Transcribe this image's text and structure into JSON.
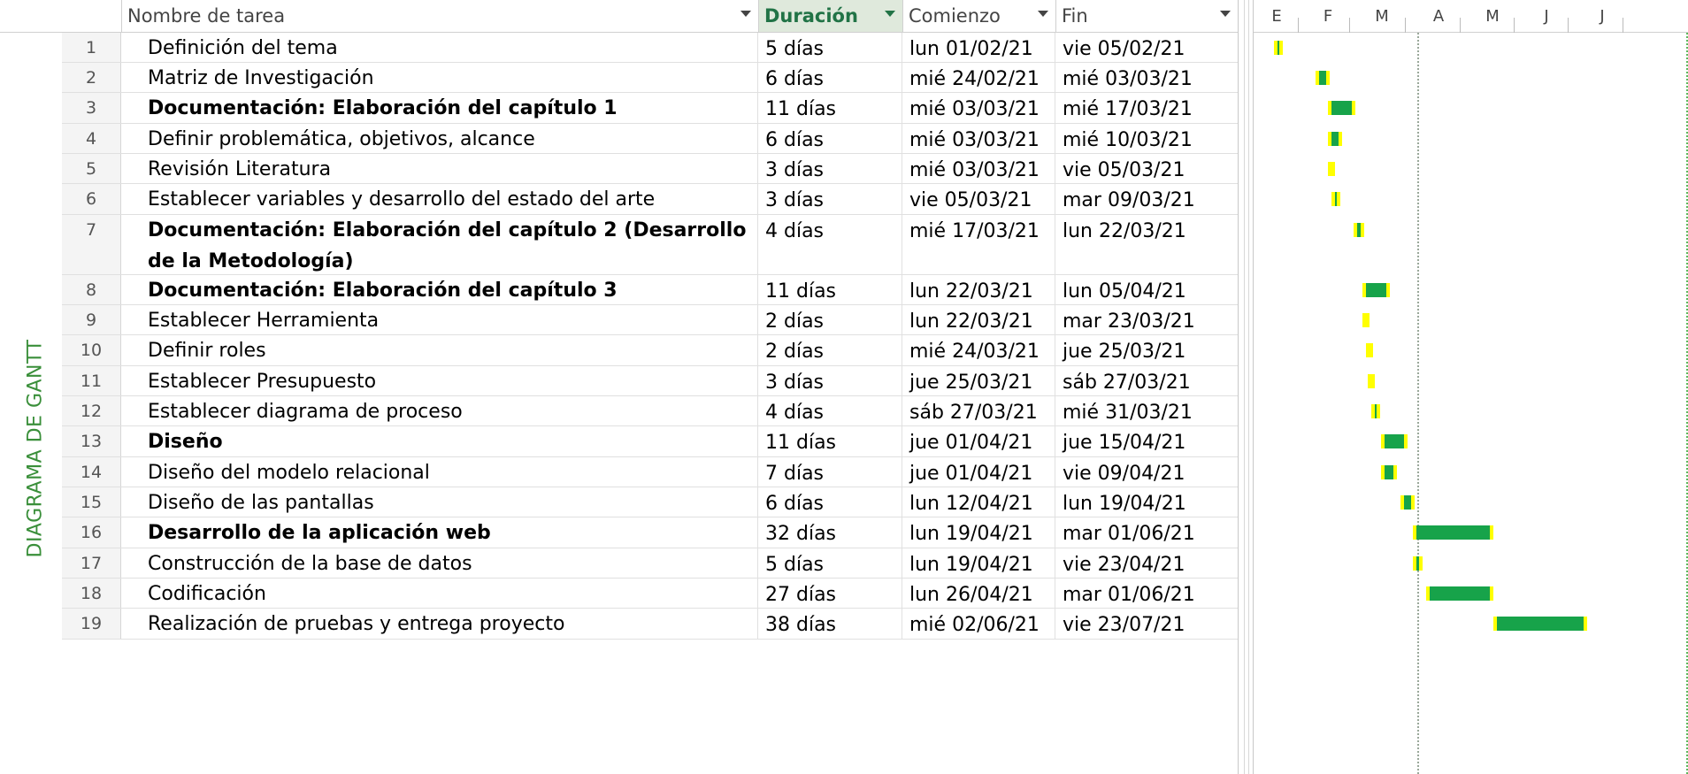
{
  "side_label": "DIAGRAMA DE GANTT",
  "columns": {
    "name": "Nombre de tarea",
    "duration": "Duración",
    "start": "Comienzo",
    "end": "Fin"
  },
  "timeline_months": [
    "E",
    "F",
    "M",
    "A",
    "M",
    "J",
    "J"
  ],
  "tasks": [
    {
      "id": "1",
      "name": "Definición del tema",
      "dur": "5 días",
      "start": "lun 01/02/21",
      "end": "vie 05/02/21",
      "bold": false
    },
    {
      "id": "2",
      "name": "Matriz de Investigación",
      "dur": "6 días",
      "start": "mié 24/02/21",
      "end": "mié 03/03/21",
      "bold": false
    },
    {
      "id": "3",
      "name": "Documentación: Elaboración del capítulo 1",
      "dur": "11 días",
      "start": "mié 03/03/21",
      "end": "mié 17/03/21",
      "bold": true
    },
    {
      "id": "4",
      "name": "Definir problemática, objetivos, alcance",
      "dur": "6 días",
      "start": "mié 03/03/21",
      "end": "mié 10/03/21",
      "bold": false
    },
    {
      "id": "5",
      "name": "Revisión Literatura",
      "dur": "3 días",
      "start": "mié 03/03/21",
      "end": "vie 05/03/21",
      "bold": false
    },
    {
      "id": "6",
      "name": "Establecer variables y desarrollo del estado del arte",
      "dur": "3 días",
      "start": "vie 05/03/21",
      "end": "mar 09/03/21",
      "bold": false
    },
    {
      "id": "7",
      "name": "Documentación: Elaboración del capítulo 2 (Desarrollo de la Metodología)",
      "dur": "4 días",
      "start": "mié 17/03/21",
      "end": "lun 22/03/21",
      "bold": true
    },
    {
      "id": "8",
      "name": "Documentación: Elaboración del capítulo 3",
      "dur": "11 días",
      "start": "lun 22/03/21",
      "end": "lun 05/04/21",
      "bold": true
    },
    {
      "id": "9",
      "name": "Establecer Herramienta",
      "dur": "2 días",
      "start": "lun 22/03/21",
      "end": "mar 23/03/21",
      "bold": false
    },
    {
      "id": "10",
      "name": "Definir roles",
      "dur": "2 días",
      "start": "mié 24/03/21",
      "end": "jue 25/03/21",
      "bold": false
    },
    {
      "id": "11",
      "name": "Establecer Presupuesto",
      "dur": "3 días",
      "start": "jue 25/03/21",
      "end": "sáb 27/03/21",
      "bold": false
    },
    {
      "id": "12",
      "name": "Establecer diagrama de proceso",
      "dur": "4 días",
      "start": "sáb 27/03/21",
      "end": "mié 31/03/21",
      "bold": false
    },
    {
      "id": "13",
      "name": "Diseño",
      "dur": "11 días",
      "start": "jue 01/04/21",
      "end": "jue 15/04/21",
      "bold": true
    },
    {
      "id": "14",
      "name": "Diseño del modelo relacional",
      "dur": "7 días",
      "start": "jue 01/04/21",
      "end": "vie 09/04/21",
      "bold": false
    },
    {
      "id": "15",
      "name": "Diseño de las pantallas",
      "dur": "6 días",
      "start": "lun 12/04/21",
      "end": "lun 19/04/21",
      "bold": false
    },
    {
      "id": "16",
      "name": "Desarrollo de la aplicación web",
      "dur": "32 días",
      "start": "lun 19/04/21",
      "end": "mar 01/06/21",
      "bold": true
    },
    {
      "id": "17",
      "name": "Construcción de la base de datos",
      "dur": "5 días",
      "start": "lun 19/04/21",
      "end": "vie 23/04/21",
      "bold": false
    },
    {
      "id": "18",
      "name": "Codificación",
      "dur": "27 días",
      "start": "lun 26/04/21",
      "end": "mar 01/06/21",
      "bold": false
    },
    {
      "id": "19",
      "name": "Realización de pruebas y entrega proyecto",
      "dur": "38 días",
      "start": "mié 02/06/21",
      "end": "vie 23/07/21",
      "bold": false
    }
  ],
  "colors": {
    "bar_green": "#17a34a",
    "bar_yellow": "#ffff00",
    "accent_green": "#217346"
  }
}
